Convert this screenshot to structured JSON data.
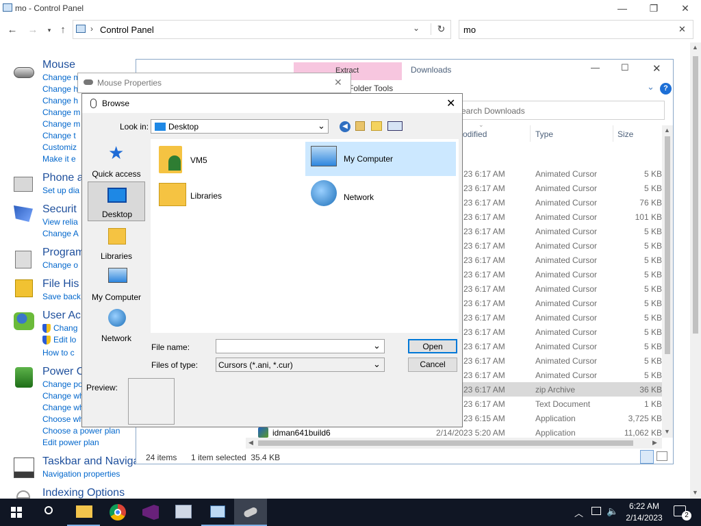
{
  "control_panel": {
    "title": "mo - Control Panel",
    "breadcrumb": "Control Panel",
    "search_value": "mo",
    "categories": [
      {
        "heading": "Mouse",
        "links": [
          "Change m",
          "Change h",
          "Change h",
          "Change m",
          "Change m",
          "Change t",
          "Customiz",
          "Make it e"
        ]
      },
      {
        "heading": "Phone a",
        "links": [
          "Set up dia"
        ]
      },
      {
        "heading": "Securit",
        "links": [
          "View relia",
          "Change A"
        ]
      },
      {
        "heading": "Program",
        "links": [
          "Change o"
        ]
      },
      {
        "heading": "File His",
        "links": [
          "Save back"
        ]
      },
      {
        "heading": "User Ac",
        "links": [
          "Chang",
          "Edit lo",
          "How to c"
        ]
      },
      {
        "heading": "Power O",
        "links": [
          "Change po",
          "Change wh",
          "Change wh",
          "Choose wh",
          "Choose a power plan",
          "Edit power plan"
        ]
      },
      {
        "heading": "Taskbar and Navigati",
        "links": [
          "Navigation properties"
        ]
      },
      {
        "heading": "Indexing Options",
        "links": []
      }
    ]
  },
  "downloads": {
    "title": "Downloads",
    "ribbon_extract": "Extract",
    "ribbon_tools": "Folder Tools",
    "search_placeholder": "earch Downloads",
    "col_modified": "odified",
    "col_type": "Type",
    "col_size": "Size",
    "rows": [
      {
        "date": "23 6:17 AM",
        "type": "Animated Cursor",
        "size": "5 KB"
      },
      {
        "date": "23 6:17 AM",
        "type": "Animated Cursor",
        "size": "5 KB"
      },
      {
        "date": "23 6:17 AM",
        "type": "Animated Cursor",
        "size": "76 KB"
      },
      {
        "date": "23 6:17 AM",
        "type": "Animated Cursor",
        "size": "101 KB"
      },
      {
        "date": "23 6:17 AM",
        "type": "Animated Cursor",
        "size": "5 KB"
      },
      {
        "date": "23 6:17 AM",
        "type": "Animated Cursor",
        "size": "5 KB"
      },
      {
        "date": "23 6:17 AM",
        "type": "Animated Cursor",
        "size": "5 KB"
      },
      {
        "date": "23 6:17 AM",
        "type": "Animated Cursor",
        "size": "5 KB"
      },
      {
        "date": "23 6:17 AM",
        "type": "Animated Cursor",
        "size": "5 KB"
      },
      {
        "date": "23 6:17 AM",
        "type": "Animated Cursor",
        "size": "5 KB"
      },
      {
        "date": "23 6:17 AM",
        "type": "Animated Cursor",
        "size": "5 KB"
      },
      {
        "date": "23 6:17 AM",
        "type": "Animated Cursor",
        "size": "5 KB"
      },
      {
        "date": "23 6:17 AM",
        "type": "Animated Cursor",
        "size": "5 KB"
      },
      {
        "date": "23 6:17 AM",
        "type": "Animated Cursor",
        "size": "5 KB"
      },
      {
        "date": "23 6:17 AM",
        "type": "Animated Cursor",
        "size": "5 KB"
      },
      {
        "date": "23 6:17 AM",
        "type": "zip Archive",
        "size": "36 KB",
        "selected": true
      },
      {
        "date": "23 6:17 AM",
        "type": "Text Document",
        "size": "1 KB"
      },
      {
        "date": "23 6:15 AM",
        "type": "Application",
        "size": "3,725 KB"
      },
      {
        "name": "idman641build6",
        "date": "2/14/2023 5:20 AM",
        "type": "Application",
        "size": "11,062 KB"
      }
    ],
    "status_items": "24 items",
    "status_selected": "1 item selected  35.4 KB"
  },
  "mouse_properties": {
    "title": "Mouse Properties"
  },
  "browse": {
    "title": "Browse",
    "look_in_label": "Look in:",
    "look_in_value": "Desktop",
    "places": [
      "Quick access",
      "Desktop",
      "Libraries",
      "My Computer",
      "Network"
    ],
    "items": [
      "VM5",
      "My Computer",
      "Libraries",
      "Network"
    ],
    "file_name_label": "File name:",
    "file_name_value": "",
    "files_of_type_label": "Files of type:",
    "files_of_type_value": "Cursors (*.ani, *.cur)",
    "open": "Open",
    "cancel": "Cancel",
    "preview": "Preview:"
  },
  "taskbar": {
    "time": "6:22 AM",
    "date": "2/14/2023",
    "notifications": "2"
  }
}
